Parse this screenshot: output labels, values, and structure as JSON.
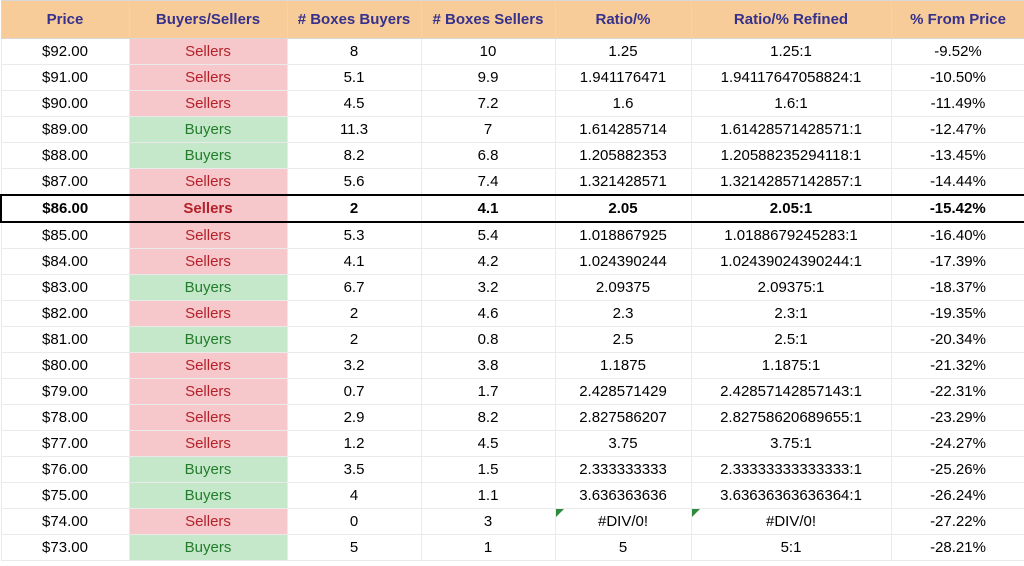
{
  "headers": {
    "price": "Price",
    "buyers_sellers": "Buyers/Sellers",
    "boxes_buyers": "# Boxes Buyers",
    "boxes_sellers": "# Boxes Sellers",
    "ratio": "Ratio/%",
    "ratio_refined": "Ratio/% Refined",
    "from_price": "% From Price"
  },
  "highlight_price": "$86.00",
  "rows": [
    {
      "price": "$92.00",
      "bs": "Sellers",
      "boxes_buyers": "8",
      "boxes_sellers": "10",
      "ratio": "1.25",
      "ratio_refined": "1.25:1",
      "from_price": "-9.52%"
    },
    {
      "price": "$91.00",
      "bs": "Sellers",
      "boxes_buyers": "5.1",
      "boxes_sellers": "9.9",
      "ratio": "1.941176471",
      "ratio_refined": "1.94117647058824:1",
      "from_price": "-10.50%"
    },
    {
      "price": "$90.00",
      "bs": "Sellers",
      "boxes_buyers": "4.5",
      "boxes_sellers": "7.2",
      "ratio": "1.6",
      "ratio_refined": "1.6:1",
      "from_price": "-11.49%"
    },
    {
      "price": "$89.00",
      "bs": "Buyers",
      "boxes_buyers": "11.3",
      "boxes_sellers": "7",
      "ratio": "1.614285714",
      "ratio_refined": "1.61428571428571:1",
      "from_price": "-12.47%"
    },
    {
      "price": "$88.00",
      "bs": "Buyers",
      "boxes_buyers": "8.2",
      "boxes_sellers": "6.8",
      "ratio": "1.205882353",
      "ratio_refined": "1.20588235294118:1",
      "from_price": "-13.45%"
    },
    {
      "price": "$87.00",
      "bs": "Sellers",
      "boxes_buyers": "5.6",
      "boxes_sellers": "7.4",
      "ratio": "1.321428571",
      "ratio_refined": "1.32142857142857:1",
      "from_price": "-14.44%"
    },
    {
      "price": "$86.00",
      "bs": "Sellers",
      "boxes_buyers": "2",
      "boxes_sellers": "4.1",
      "ratio": "2.05",
      "ratio_refined": "2.05:1",
      "from_price": "-15.42%"
    },
    {
      "price": "$85.00",
      "bs": "Sellers",
      "boxes_buyers": "5.3",
      "boxes_sellers": "5.4",
      "ratio": "1.018867925",
      "ratio_refined": "1.0188679245283:1",
      "from_price": "-16.40%"
    },
    {
      "price": "$84.00",
      "bs": "Sellers",
      "boxes_buyers": "4.1",
      "boxes_sellers": "4.2",
      "ratio": "1.024390244",
      "ratio_refined": "1.02439024390244:1",
      "from_price": "-17.39%"
    },
    {
      "price": "$83.00",
      "bs": "Buyers",
      "boxes_buyers": "6.7",
      "boxes_sellers": "3.2",
      "ratio": "2.09375",
      "ratio_refined": "2.09375:1",
      "from_price": "-18.37%"
    },
    {
      "price": "$82.00",
      "bs": "Sellers",
      "boxes_buyers": "2",
      "boxes_sellers": "4.6",
      "ratio": "2.3",
      "ratio_refined": "2.3:1",
      "from_price": "-19.35%"
    },
    {
      "price": "$81.00",
      "bs": "Buyers",
      "boxes_buyers": "2",
      "boxes_sellers": "0.8",
      "ratio": "2.5",
      "ratio_refined": "2.5:1",
      "from_price": "-20.34%"
    },
    {
      "price": "$80.00",
      "bs": "Sellers",
      "boxes_buyers": "3.2",
      "boxes_sellers": "3.8",
      "ratio": "1.1875",
      "ratio_refined": "1.1875:1",
      "from_price": "-21.32%"
    },
    {
      "price": "$79.00",
      "bs": "Sellers",
      "boxes_buyers": "0.7",
      "boxes_sellers": "1.7",
      "ratio": "2.428571429",
      "ratio_refined": "2.42857142857143:1",
      "from_price": "-22.31%"
    },
    {
      "price": "$78.00",
      "bs": "Sellers",
      "boxes_buyers": "2.9",
      "boxes_sellers": "8.2",
      "ratio": "2.827586207",
      "ratio_refined": "2.82758620689655:1",
      "from_price": "-23.29%"
    },
    {
      "price": "$77.00",
      "bs": "Sellers",
      "boxes_buyers": "1.2",
      "boxes_sellers": "4.5",
      "ratio": "3.75",
      "ratio_refined": "3.75:1",
      "from_price": "-24.27%"
    },
    {
      "price": "$76.00",
      "bs": "Buyers",
      "boxes_buyers": "3.5",
      "boxes_sellers": "1.5",
      "ratio": "2.333333333",
      "ratio_refined": "2.33333333333333:1",
      "from_price": "-25.26%"
    },
    {
      "price": "$75.00",
      "bs": "Buyers",
      "boxes_buyers": "4",
      "boxes_sellers": "1.1",
      "ratio": "3.636363636",
      "ratio_refined": "3.63636363636364:1",
      "from_price": "-26.24%"
    },
    {
      "price": "$74.00",
      "bs": "Sellers",
      "boxes_buyers": "0",
      "boxes_sellers": "3",
      "ratio": "#DIV/0!",
      "ratio_refined": "#DIV/0!",
      "from_price": "-27.22%",
      "error_flag": true
    },
    {
      "price": "$73.00",
      "bs": "Buyers",
      "boxes_buyers": "5",
      "boxes_sellers": "1",
      "ratio": "5",
      "ratio_refined": "5:1",
      "from_price": "-28.21%"
    }
  ]
}
